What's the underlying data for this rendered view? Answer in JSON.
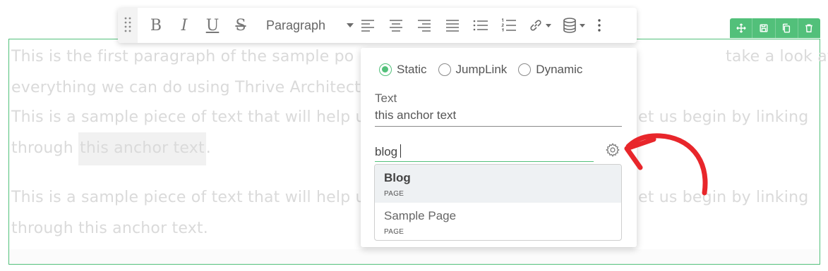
{
  "editor": {
    "paragraph_1": {
      "line_1": "This is the first paragraph of the sample po",
      "line_1_end": "take a look at",
      "line_2": "everything we can do using Thrive Architect"
    },
    "paragraph_2": {
      "line_1": "This is a sample piece of text that will help u",
      "line_1_end": "et us begin by linking",
      "line_2_start": "through ",
      "anchor": "this anchor text",
      "line_2_end": "."
    },
    "paragraph_3": {
      "line_1": "This is a sample piece of text that will help u",
      "line_1_end": "et us begin by linking",
      "line_2": "through this anchor text."
    }
  },
  "toolbar": {
    "bold": "B",
    "italic": "I",
    "underline": "U",
    "strike": "S",
    "paragraph_select": "Paragraph"
  },
  "link_popup": {
    "link_types": [
      {
        "label": "Static",
        "checked": true
      },
      {
        "label": "JumpLink",
        "checked": false
      },
      {
        "label": "Dynamic",
        "checked": false
      }
    ],
    "text_label": "Text",
    "text_value": "this anchor text",
    "search_value": "blog",
    "results": [
      {
        "title": "Blog",
        "type": "PAGE"
      },
      {
        "title": "Sample Page",
        "type": "PAGE"
      }
    ]
  },
  "colors": {
    "accent": "#52c07a",
    "arrow": "#e8262b"
  },
  "icons": [
    "drag-handle-icon",
    "align-left-icon",
    "align-center-icon",
    "align-right-icon",
    "justify-icon",
    "bullet-list-icon",
    "numbered-list-icon",
    "link-icon",
    "database-icon",
    "more-icon",
    "move-icon",
    "save-icon",
    "copy-icon",
    "trash-icon",
    "gear-icon"
  ]
}
